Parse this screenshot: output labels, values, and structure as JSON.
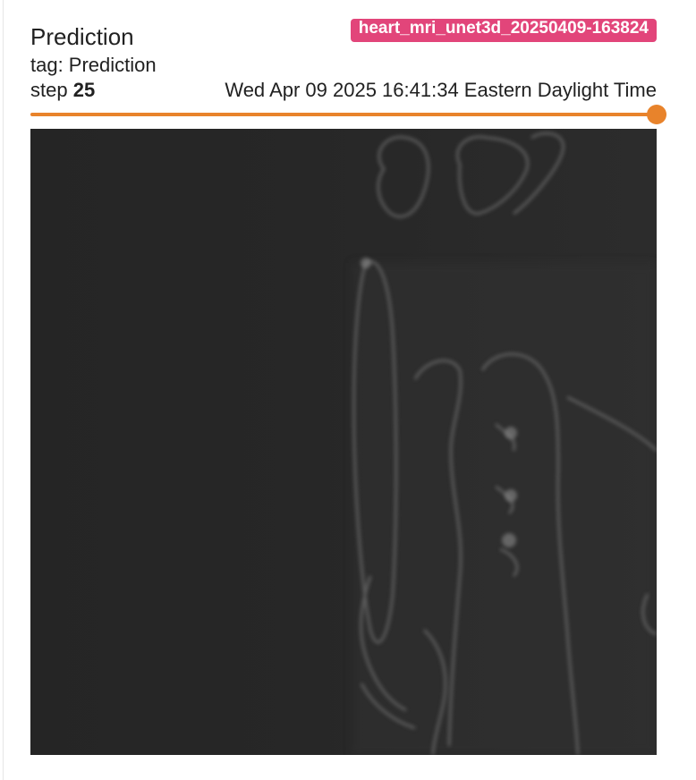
{
  "card": {
    "title": "Prediction",
    "run_badge": "heart_mri_unet3d_20250409-163824",
    "tag_line": "tag: Prediction",
    "step_prefix": "step",
    "step_value": "25",
    "timestamp": "Wed Apr 09 2025 16:41:34 Eastern Daylight Time",
    "step_progress": 1.0
  },
  "colors": {
    "badge_bg": "#e2457a",
    "slider_accent": "#e8832b",
    "image_bg": "#262626"
  }
}
